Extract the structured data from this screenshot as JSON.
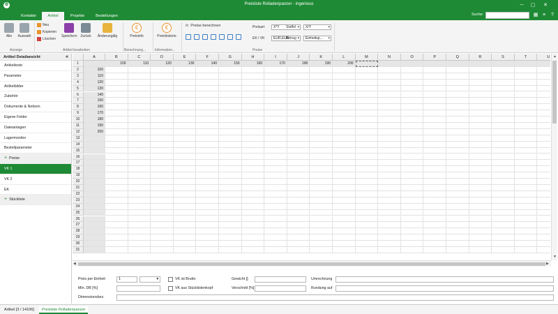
{
  "window": {
    "title": "Preisliste Rolladenpanzer - ingenious",
    "logo": "app-logo-icon",
    "minimize": "─",
    "maximize": "▢",
    "close": "✕"
  },
  "menubar": {
    "tabs": [
      "Kontakte",
      "Artikel",
      "Projekte",
      "Bestellungen"
    ],
    "active_tab": "Artikel",
    "search_label": "Suche:",
    "search_value": "",
    "icons": [
      "layout-icon",
      "menu-icon",
      "help-icon"
    ]
  },
  "ribbon": {
    "groups": {
      "anzeige": "Anzeige",
      "artikel_bearbeiten": "Artikel bearbeiten",
      "berechnung": "Berechnung...",
      "information": "Information...",
      "preise": "Preise"
    },
    "buttons": {
      "alle": "Alle",
      "auswahl": "Auswahl",
      "neu": "Neu",
      "kopieren": "Kopieren",
      "loeschen": "Löschen",
      "speichern": "Speichern",
      "zurueck": "Zurück",
      "aenderungsdialog": "Änderungdlg",
      "preisinfo": "Preisinfo",
      "preishistorie": "Preishistorie",
      "preise_berechnen": "Preise berechnen"
    },
    "fields": {
      "preisart_label": "Preisart",
      "preisart_value": "X*Y",
      "ek_vk_label": "EK / VK",
      "ek_vk_value": "EUR,EUR",
      "staffel_label": "Staffel",
      "staffel_value": "X/Y",
      "betrag_label": "Betrag",
      "betrag_value": "Einheitsp..."
    },
    "colors": {
      "accent": "#1f8a35",
      "icon_blue": "#3d7dc7",
      "icon_orange": "#e8932d",
      "icon_purple": "#8c3fa8"
    }
  },
  "sidebar": {
    "header": "Artikel Detailansicht",
    "collapse": "«",
    "items": [
      {
        "label": "Artikeltexte",
        "type": "item"
      },
      {
        "label": "Parameter",
        "type": "item"
      },
      {
        "label": "Artikelbilder",
        "type": "item"
      },
      {
        "label": "Zubehör",
        "type": "item"
      },
      {
        "label": "Dokumente & Notizen",
        "type": "item"
      },
      {
        "label": "Eigene Felder",
        "type": "item"
      },
      {
        "label": "Dateianlagen",
        "type": "item"
      },
      {
        "label": "Lagermonitor",
        "type": "item"
      },
      {
        "label": "Bestellparameter",
        "type": "item"
      },
      {
        "label": "Preise",
        "type": "group"
      },
      {
        "label": "VK 1",
        "type": "active"
      },
      {
        "label": "VK 2",
        "type": "item"
      },
      {
        "label": "EK",
        "type": "item"
      },
      {
        "label": "Stückliste",
        "type": "group"
      }
    ]
  },
  "sheet": {
    "columns": [
      "A",
      "B",
      "C",
      "D",
      "E",
      "F",
      "G",
      "H",
      "I",
      "J",
      "K",
      "L",
      "M",
      "N",
      "O",
      "P",
      "Q",
      "R",
      "S",
      "T",
      "U"
    ],
    "row_count": 31,
    "header_row_values": [
      "100",
      "110",
      "120",
      "130",
      "140",
      "150",
      "160",
      "170",
      "180",
      "190",
      "200"
    ],
    "header_col_values": [
      "100",
      "110",
      "120",
      "130",
      "140",
      "150",
      "160",
      "170",
      "180",
      "190",
      "200"
    ]
  },
  "form": {
    "preis_per_einheit_label": "Preis per Einheit",
    "preis_per_einheit_value": "1",
    "vk_ist_brutto_label": "VK ist Brutto",
    "gewicht_label": "Gewicht []",
    "umrechnung_label": "Umrechnung",
    "min_db_label": "Min. DB [%]",
    "vk_aus_stueckliste_label": "VK aus Stücklistenkopf",
    "verschnitt_label": "Verschnitt [%]",
    "rundung_auf_label": "Rundung auf",
    "dimensionsbez_label": "Dimensionsbez."
  },
  "statusbar": {
    "tabs": [
      "Artikel [3 / 14106]",
      "Preisliste Rolladenpanzer"
    ],
    "active": 1
  }
}
